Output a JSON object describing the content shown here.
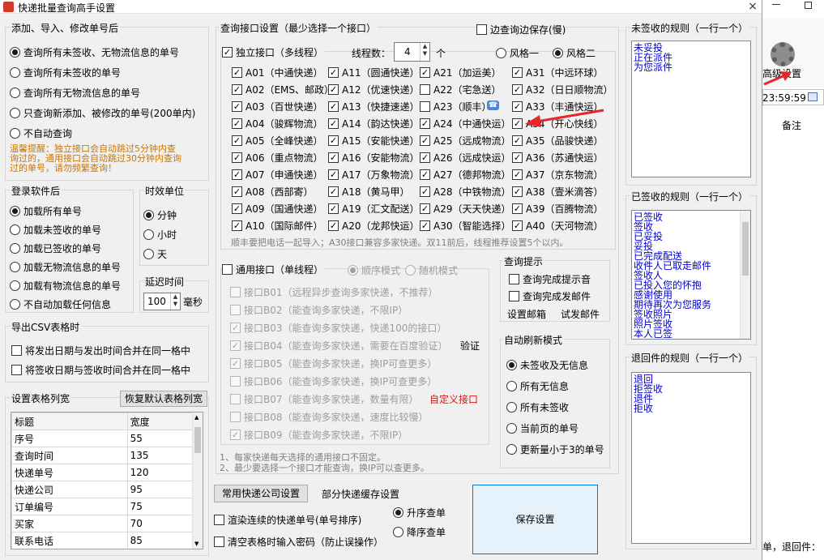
{
  "window": {
    "title": "快递批量查询高手设置",
    "close": "×"
  },
  "add_group": {
    "title": "添加、导入、修改单号后",
    "options": [
      "查询所有未签收、无物流信息的单号",
      "查询所有未签收的单号",
      "查询所有无物流信息的单号",
      "只查询新添加、被修改的单号(200单内)",
      "不自动查询"
    ],
    "selected": 0,
    "tip": [
      "温馨提醒：独立接口会自动跳过5分钟内查",
      "询过的，通用接口会自动跳过30分钟内查询",
      "过的单号，请勿频繁查询！"
    ]
  },
  "login_group": {
    "title": "登录软件后",
    "options": [
      "加载所有单号",
      "加载未签收的单号",
      "加载已签收的单号",
      "加载无物流信息的单号",
      "加载有物流信息的单号",
      "不自动加载任何信息"
    ],
    "selected": 0
  },
  "time_unit": {
    "title": "时效单位",
    "options": [
      "分钟",
      "小时",
      "天"
    ],
    "selected": 0
  },
  "delay": {
    "title": "延迟时间",
    "value": "100",
    "unit": "毫秒"
  },
  "csv": {
    "title": "导出CSV表格时",
    "options": [
      "将发出日期与发出时间合并在同一格中",
      "将签收日期与签收时间合并在同一格中"
    ]
  },
  "columns": {
    "title": "设置表格列宽",
    "reset_label": "恢复默认表格列宽",
    "headers": [
      "标题",
      "宽度"
    ],
    "rows": [
      [
        "序号",
        "55"
      ],
      [
        "查询时间",
        "135"
      ],
      [
        "快递单号",
        "120"
      ],
      [
        "快递公司",
        "95"
      ],
      [
        "订单编号",
        "75"
      ],
      [
        "买家",
        "70"
      ],
      [
        "联系电话",
        "85"
      ]
    ]
  },
  "api": {
    "title": "查询接口设置（最少选择一个接口）",
    "save_while": "边查询边保存(慢)",
    "independent": "独立接口（多线程）",
    "threads_label": "线程数：",
    "threads": "4",
    "threads_unit": "个",
    "style1": "风格一",
    "style2": "风格二",
    "col1": [
      "A01（中通快递）",
      "A02（EMS、邮政）",
      "A03（百世快递）",
      "A04（骏辉物流）",
      "A05（全峰快递）",
      "A06（重点物流）",
      "A07（申通快递）",
      "A08（西部寄）",
      "A09（国通快递）",
      "A10（国际邮件）"
    ],
    "col2": [
      "A11（圆通快递）",
      "A12（优速快递）",
      "A13（快捷速递）",
      "A14（韵达快递）",
      "A15（安能快递）",
      "A16（安能物流）",
      "A17（万象物流）",
      "A18（黄马甲）",
      "A19（汇文配送）",
      "A20（龙邦快运）"
    ],
    "col3": [
      "A21（加运美）",
      "A22（宅急送）",
      "A23（顺丰）",
      "A24（中通快运）",
      "A25（远成物流）",
      "A26（远成快运）",
      "A27（德邦物流）",
      "A28（中铁物流）",
      "A29（天天快递）",
      "A30（智能选择）"
    ],
    "col4": [
      "A31（中远环球）",
      "A32（日日顺物流）",
      "A33（丰通快运）",
      "A34（开心快线）",
      "A35（品骏快递）",
      "A36（苏通快运）",
      "A37（京东物流）",
      "A38（壹米滴答）",
      "A39（百腾物流）",
      "A40（天河物流）"
    ],
    "col3_checked": [
      true,
      false,
      false,
      true,
      true,
      true,
      true,
      true,
      true,
      true
    ],
    "note": "顺丰要把电话一起导入；A30接口兼容多家快递。双11前后，线程推荐设置5个以内。"
  },
  "generic": {
    "label": "通用接口（单线程）",
    "seq": "顺序模式",
    "rand": "随机模式",
    "items": [
      "接口B01（远程异步查询多家快递，不推荐）",
      "接口B02（能查询多家快递，不限IP）",
      "接口B03（能查询多家快递，快递100的接口）",
      "接口B04（能查询多家快递，需要在百度验证）",
      "接口B05（能查询多家快递，换IP可查更多）",
      "接口B06（能查询多家快递，换IP可查更多）",
      "接口B07（能查询多家快递，数量有限）",
      "接口B08（能查询多家快递，速度比较慢）",
      "接口B09（能查询多家快递，不限IP）"
    ],
    "checked": [
      false,
      false,
      true,
      true,
      true,
      false,
      false,
      false,
      true
    ],
    "verify": "验证",
    "custom": "自定义接口",
    "note1": "1、每家快递每天选择的通用接口不固定。",
    "note2": "2、最少要选择一个接口才能查询，换IP可以查更多。"
  },
  "hint": {
    "title": "查询提示",
    "sound": "查询完成提示音",
    "mail": "查询完成发邮件",
    "set_mail": "设置邮箱",
    "test_mail": "试发邮件"
  },
  "refresh": {
    "title": "自动刷新模式",
    "options": [
      "未签收及无信息",
      "所有无信息",
      "所有未签收",
      "当前页的单号",
      "更新量小于3的单号"
    ],
    "selected": 0
  },
  "bottom": {
    "common_companies": "常用快递公司设置",
    "cache": "部分快递缓存设置",
    "render_chk": "渲染连续的快递单号(单号排序)",
    "clear_chk": "清空表格时输入密码（防止误操作）",
    "asc": "升序查单",
    "desc": "降序查单",
    "save": "保存设置"
  },
  "rules": {
    "unsigned_title": "未签收的规则（一行一个）",
    "unsigned": [
      "未妥投",
      "正在派件",
      "为您派件"
    ],
    "signed_title": "已签收的规则（一行一个）",
    "signed": [
      "已签收",
      "签收",
      "已妥投",
      "妥投",
      "已完成配送",
      "收件人已取走邮件",
      "签收人",
      "已投入您的怀抱",
      "感谢使用",
      "期待再次为您服务",
      "签收照片",
      "照片签收",
      "本人已签"
    ],
    "return_title": "退回件的规则（一行一个）",
    "return": [
      "退回",
      "拒签收",
      "退件",
      "拒收"
    ]
  },
  "bgapp": {
    "settings_label": "高级设置",
    "time": "23:59:59",
    "col_note": "备注",
    "status": "单，退回件："
  }
}
